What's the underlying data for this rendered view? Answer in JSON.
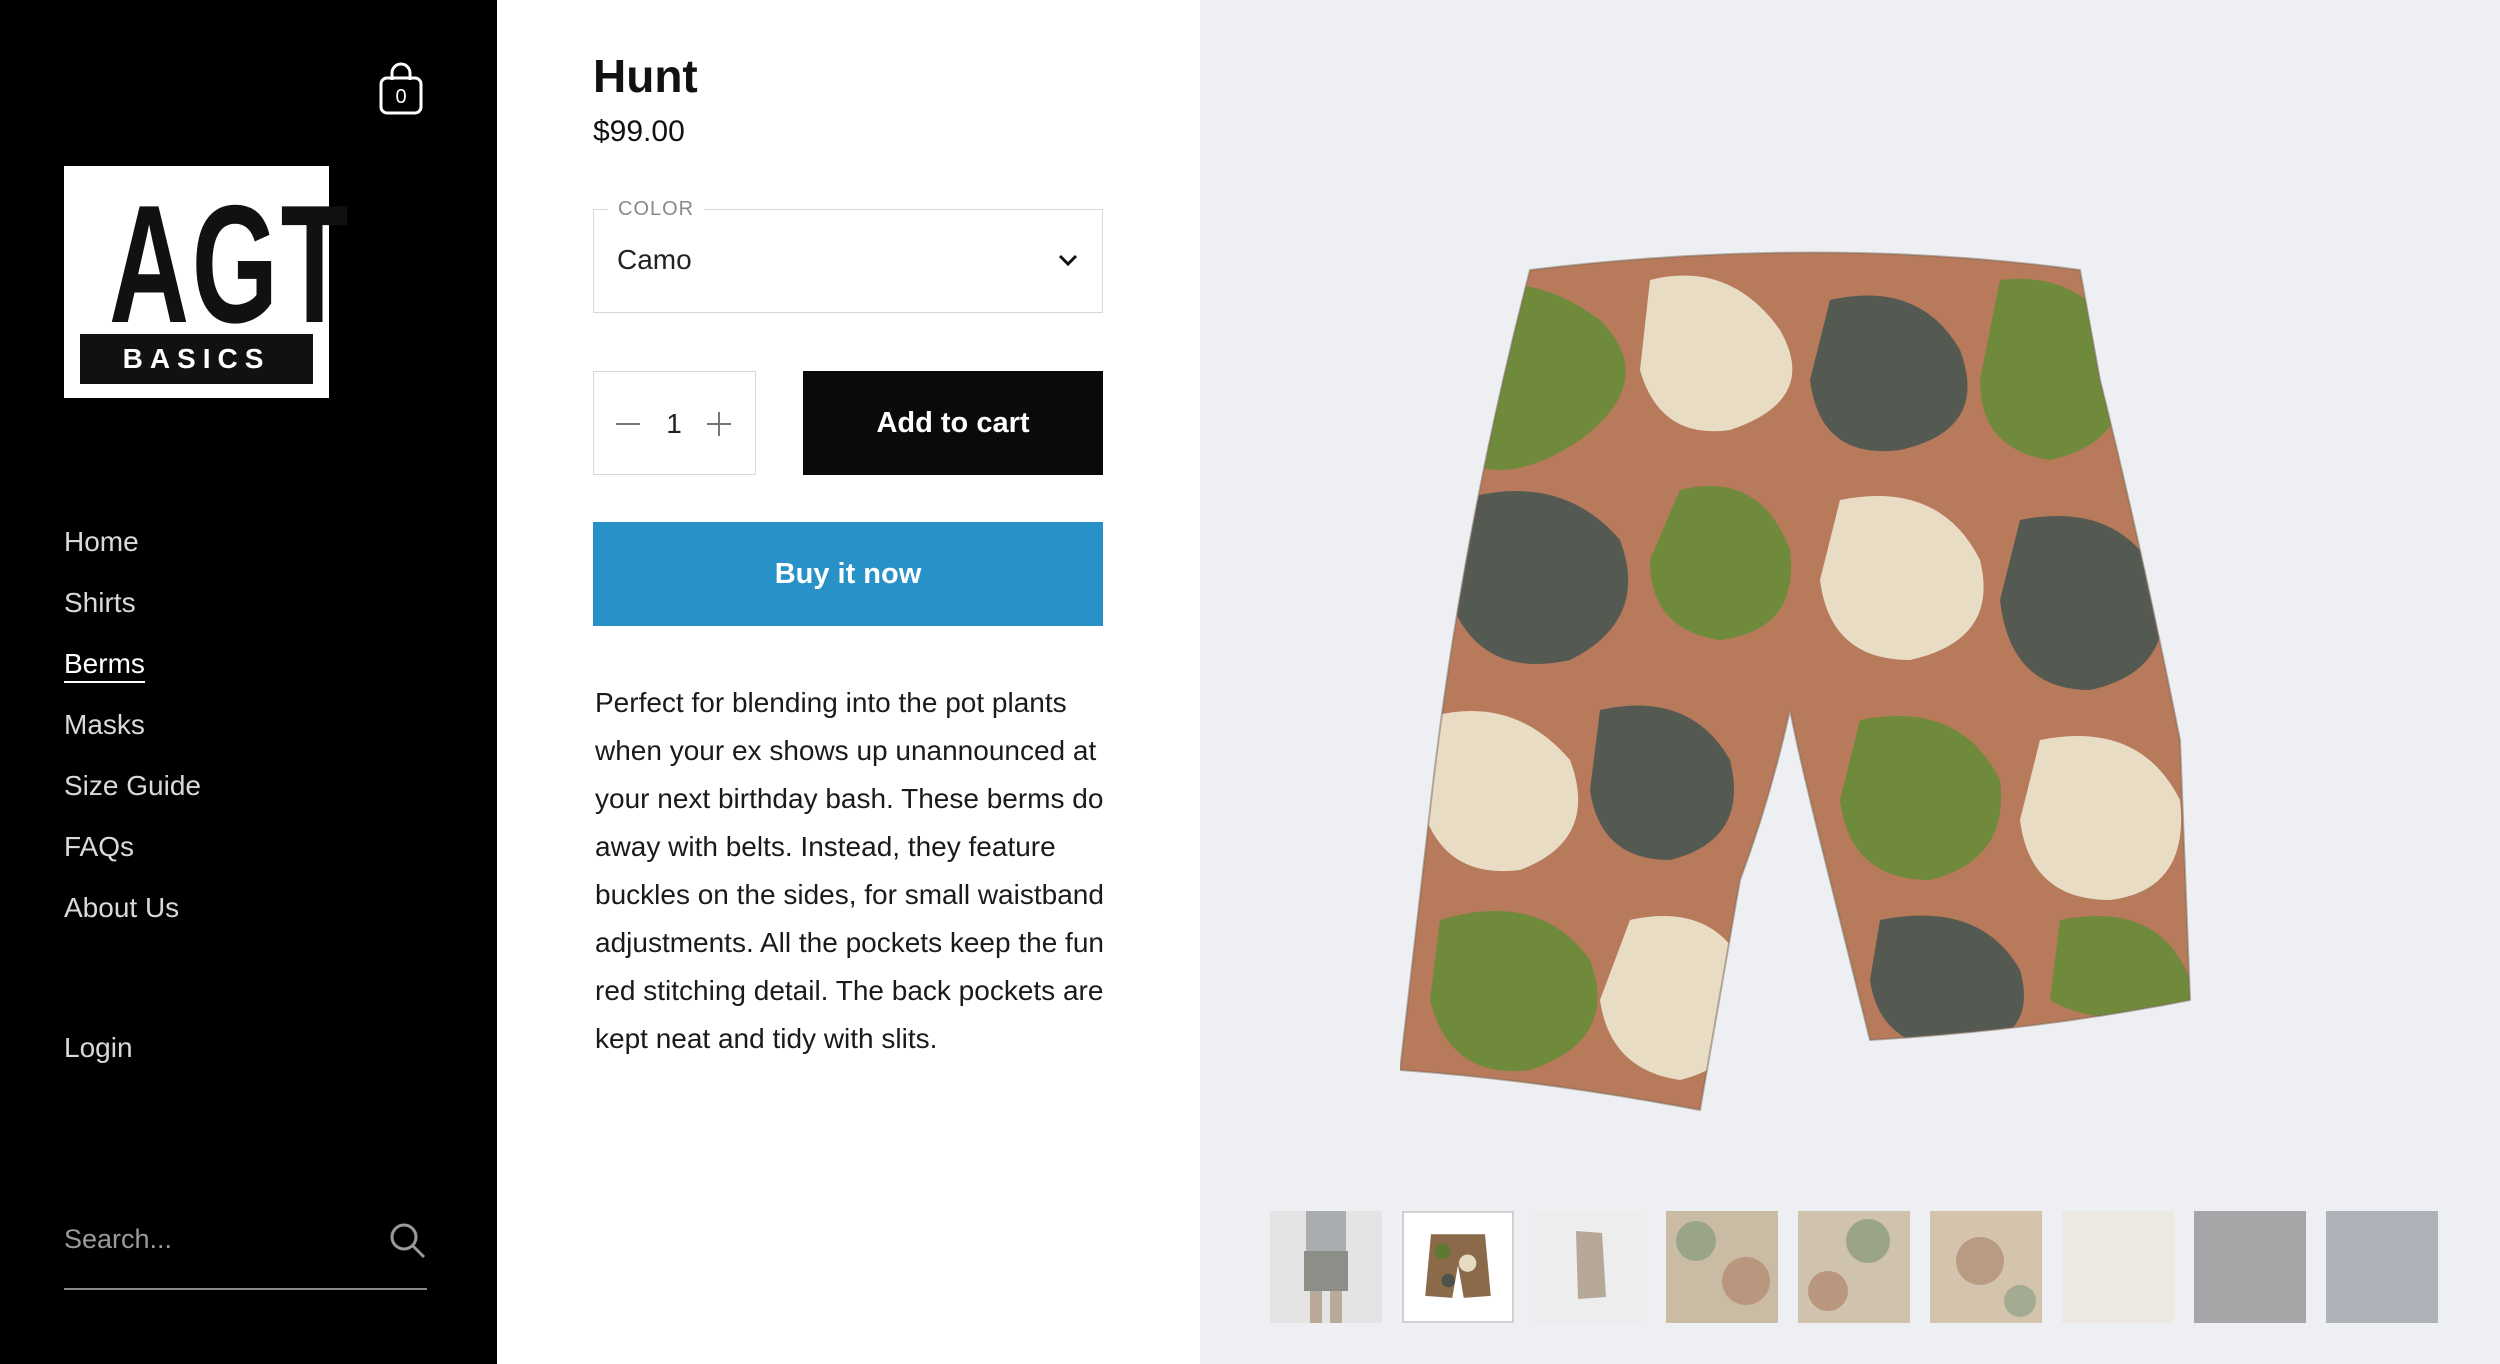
{
  "sidebar": {
    "cart_count": "0",
    "logo": {
      "top": "AGT",
      "bottom": "BASICS"
    },
    "nav": [
      "Home",
      "Shirts",
      "Berms",
      "Masks",
      "Size Guide",
      "FAQs",
      "About Us"
    ],
    "active_nav": "Berms",
    "login": "Login",
    "search_placeholder": "Search..."
  },
  "product": {
    "title": "Hunt",
    "price": "$99.00",
    "option_label": "COLOR",
    "option_value": "Camo",
    "quantity": "1",
    "add_to_cart": "Add to cart",
    "buy_now": "Buy it now",
    "description": "Perfect for blending into the pot plants when your ex shows up unannounced at your next birthday bash. These berms do away with belts. Instead, they feature buckles on the sides, for small waistband adjustments. All the pockets keep the fun red stitching detail. The back pockets are kept neat and tidy with slits."
  },
  "gallery": {
    "main_image": "camo-shorts-front",
    "thumbnails": [
      "model-shorts",
      "camo-shorts-front",
      "camo-shorts-side",
      "camo-detail-1",
      "camo-detail-2",
      "camo-detail-3",
      "cream-fabric",
      "grey-fabric",
      "grey-blue-fabric"
    ],
    "selected_index": 1
  },
  "colors": {
    "sidebar_bg": "#000000",
    "add_button": "#0a0a0a",
    "buy_button": "#2891c8",
    "gallery_bg": "#eeeff2"
  }
}
